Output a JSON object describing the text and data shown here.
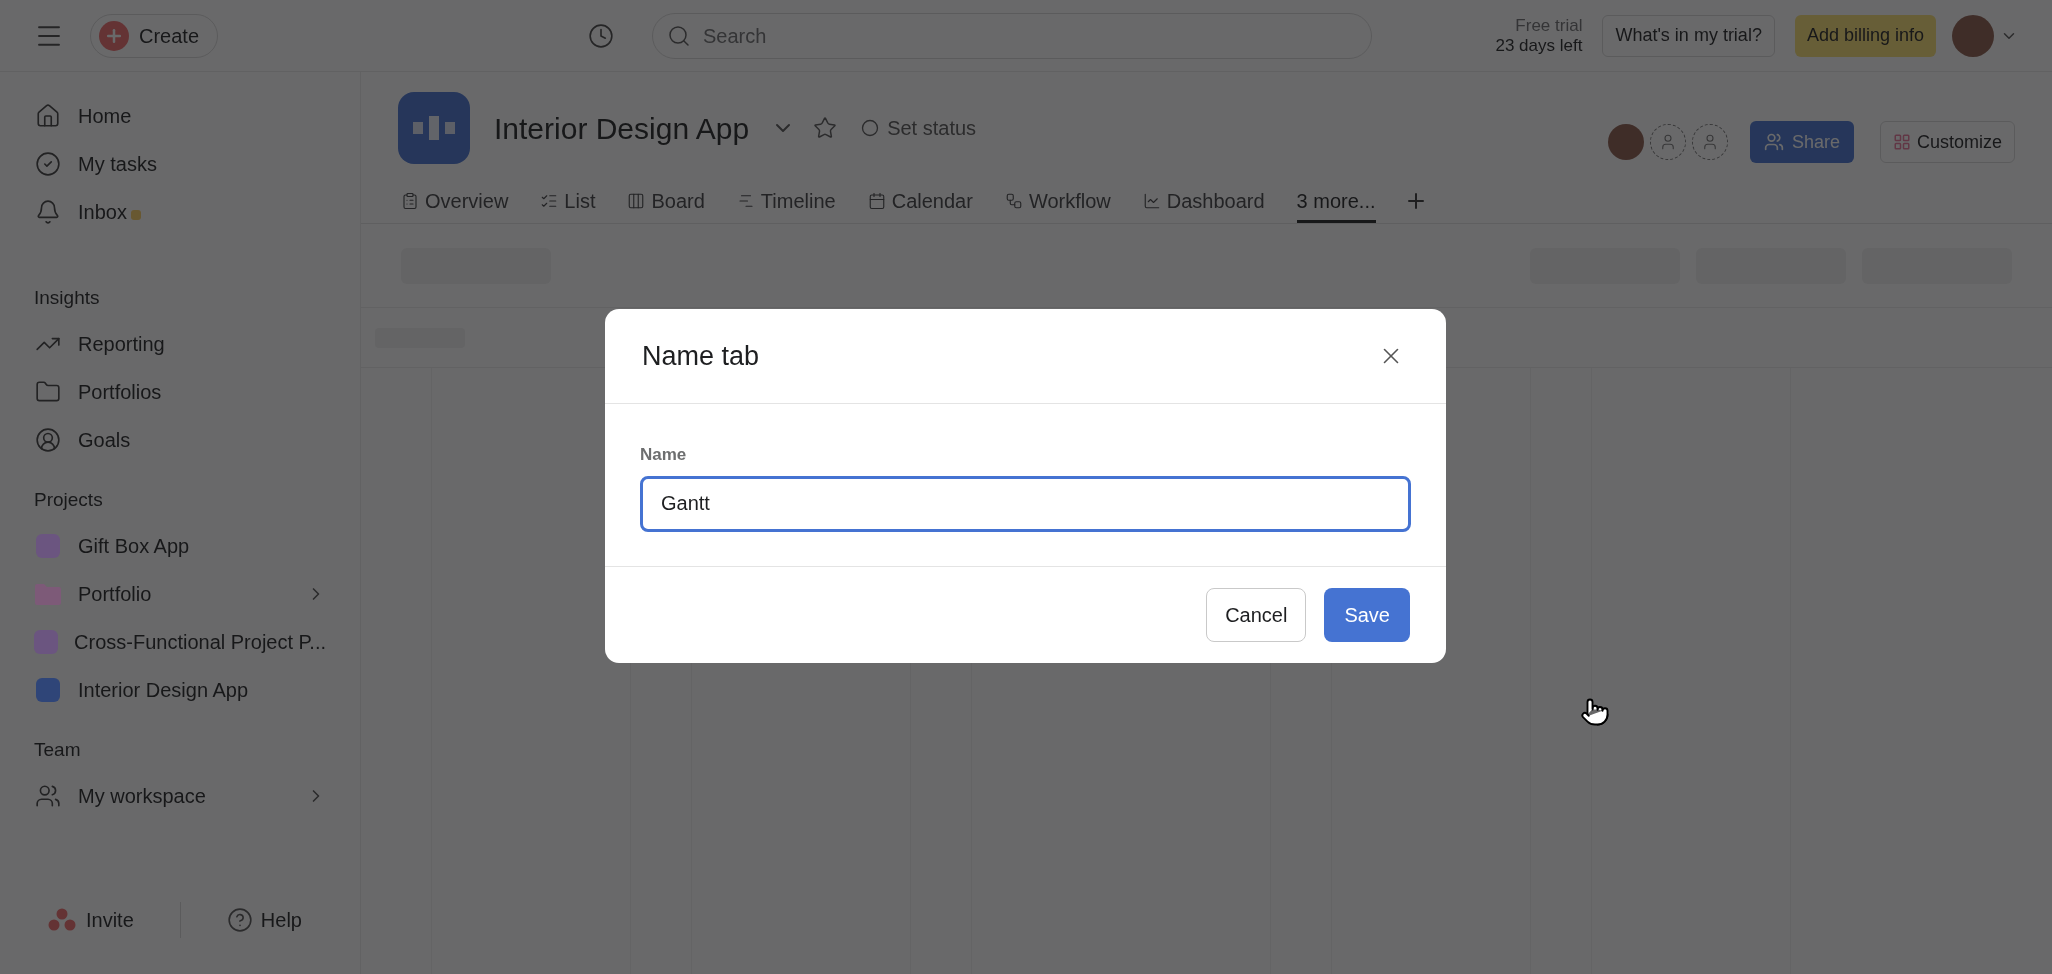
{
  "topbar": {
    "create": "Create",
    "search_placeholder": "Search",
    "trial_line1": "Free trial",
    "trial_line2": "23 days left",
    "trial_button": "What's in my trial?",
    "billing_button": "Add billing info"
  },
  "sidebar": {
    "nav": [
      {
        "label": "Home",
        "unread": false
      },
      {
        "label": "My tasks",
        "unread": false
      },
      {
        "label": "Inbox",
        "unread": true
      }
    ],
    "sections": [
      {
        "title": "Insights",
        "items": [
          {
            "label": "Reporting",
            "kind": "icon",
            "expandable": false
          },
          {
            "label": "Portfolios",
            "kind": "icon",
            "expandable": false
          },
          {
            "label": "Goals",
            "kind": "icon",
            "expandable": false
          }
        ]
      },
      {
        "title": "Projects",
        "items": [
          {
            "label": "Gift Box App",
            "kind": "project",
            "color": "#6b5580",
            "expandable": false
          },
          {
            "label": "Portfolio",
            "kind": "folder",
            "color": "#7d5a78",
            "expandable": true
          },
          {
            "label": "Cross-Functional Project P...",
            "kind": "project",
            "color": "#6b5580",
            "expandable": false
          },
          {
            "label": "Interior Design App",
            "kind": "project",
            "color": "#2f4578",
            "expandable": false
          }
        ]
      },
      {
        "title": "Team",
        "items": [
          {
            "label": "My workspace",
            "kind": "icon",
            "expandable": true
          }
        ]
      }
    ],
    "invite": "Invite",
    "help": "Help"
  },
  "project": {
    "title": "Interior Design App",
    "status": "Set status",
    "share": "Share",
    "customize": "Customize",
    "tabs": [
      {
        "label": "Overview",
        "selected": false
      },
      {
        "label": "List",
        "selected": false
      },
      {
        "label": "Board",
        "selected": false
      },
      {
        "label": "Timeline",
        "selected": false
      },
      {
        "label": "Calendar",
        "selected": false
      },
      {
        "label": "Workflow",
        "selected": false
      },
      {
        "label": "Dashboard",
        "selected": false
      },
      {
        "label": "3 more...",
        "selected": true
      }
    ]
  },
  "modal": {
    "title": "Name tab",
    "field_label": "Name",
    "value": "Gantt",
    "cancel": "Cancel",
    "save": "Save"
  }
}
